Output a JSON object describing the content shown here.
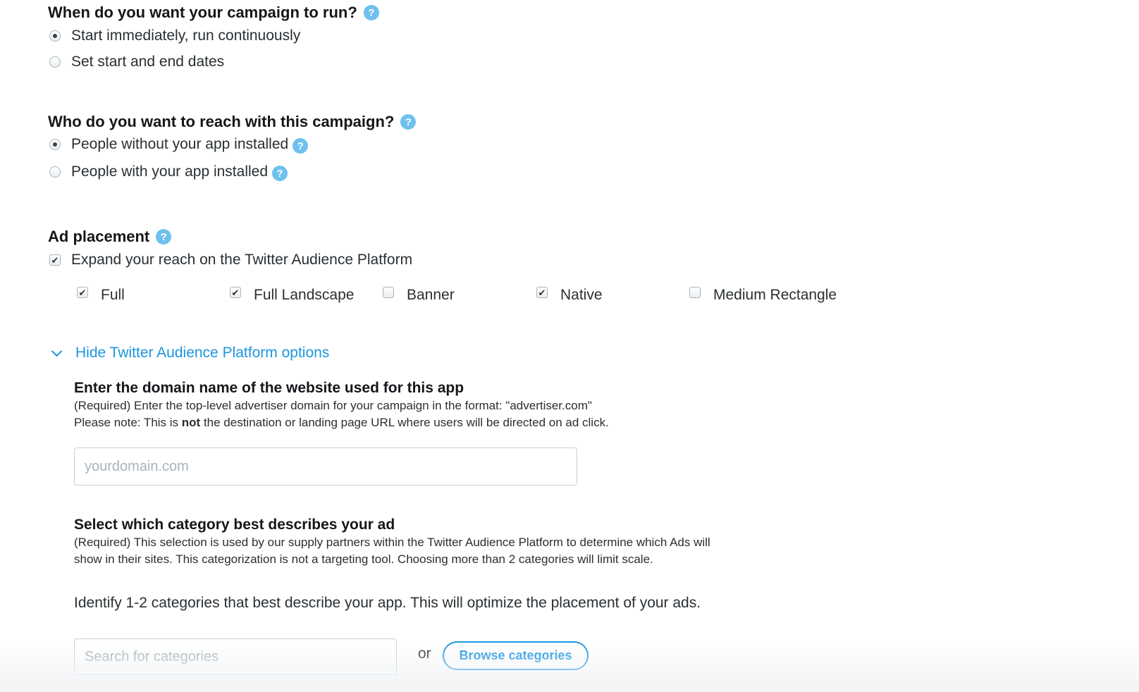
{
  "schedule": {
    "question": "When do you want your campaign to run?",
    "help_icon": "question-circle-icon",
    "options": [
      {
        "label": "Start immediately, run continuously",
        "selected": true
      },
      {
        "label": "Set start and end dates",
        "selected": false
      }
    ]
  },
  "audience": {
    "question": "Who do you want to reach with this campaign?",
    "options": [
      {
        "label": "People without your app installed",
        "selected": true
      },
      {
        "label": "People with your app installed",
        "selected": false
      }
    ]
  },
  "placement": {
    "title": "Ad placement",
    "expand_label": "Expand your reach on the Twitter Audience Platform",
    "expand_checked": true,
    "formats": [
      {
        "label": "Full",
        "checked": true
      },
      {
        "label": "Full Landscape",
        "checked": true
      },
      {
        "label": "Banner",
        "checked": false
      },
      {
        "label": "Native",
        "checked": true
      },
      {
        "label": "Medium Rectangle",
        "checked": false
      }
    ],
    "toggle_label": "Hide Twitter Audience Platform options"
  },
  "domain": {
    "title": "Enter the domain name of the website used for this app",
    "line1": "(Required) Enter the top-level advertiser domain for your campaign in the format: \"advertiser.com\"",
    "line2_prefix": "Please note: This is ",
    "line2_bold": "not",
    "line2_suffix": " the destination or landing page URL where users will be directed on ad click.",
    "placeholder": "yourdomain.com",
    "value": ""
  },
  "category": {
    "title": "Select which category best describes your ad",
    "description": "(Required) This selection is used by our supply partners within the Twitter Audience Platform to determine which Ads will show in their sites. This categorization is not a targeting tool. Choosing more than 2 categories will limit scale.",
    "identify": "Identify 1-2 categories that best describe your app. This will optimize the placement of your ads.",
    "search_placeholder": "Search for categories",
    "or_label": "or",
    "browse_label": "Browse categories"
  },
  "colors": {
    "accent": "#1b95e0",
    "help_icon": "#6ec1ee",
    "text": "#292f33"
  }
}
